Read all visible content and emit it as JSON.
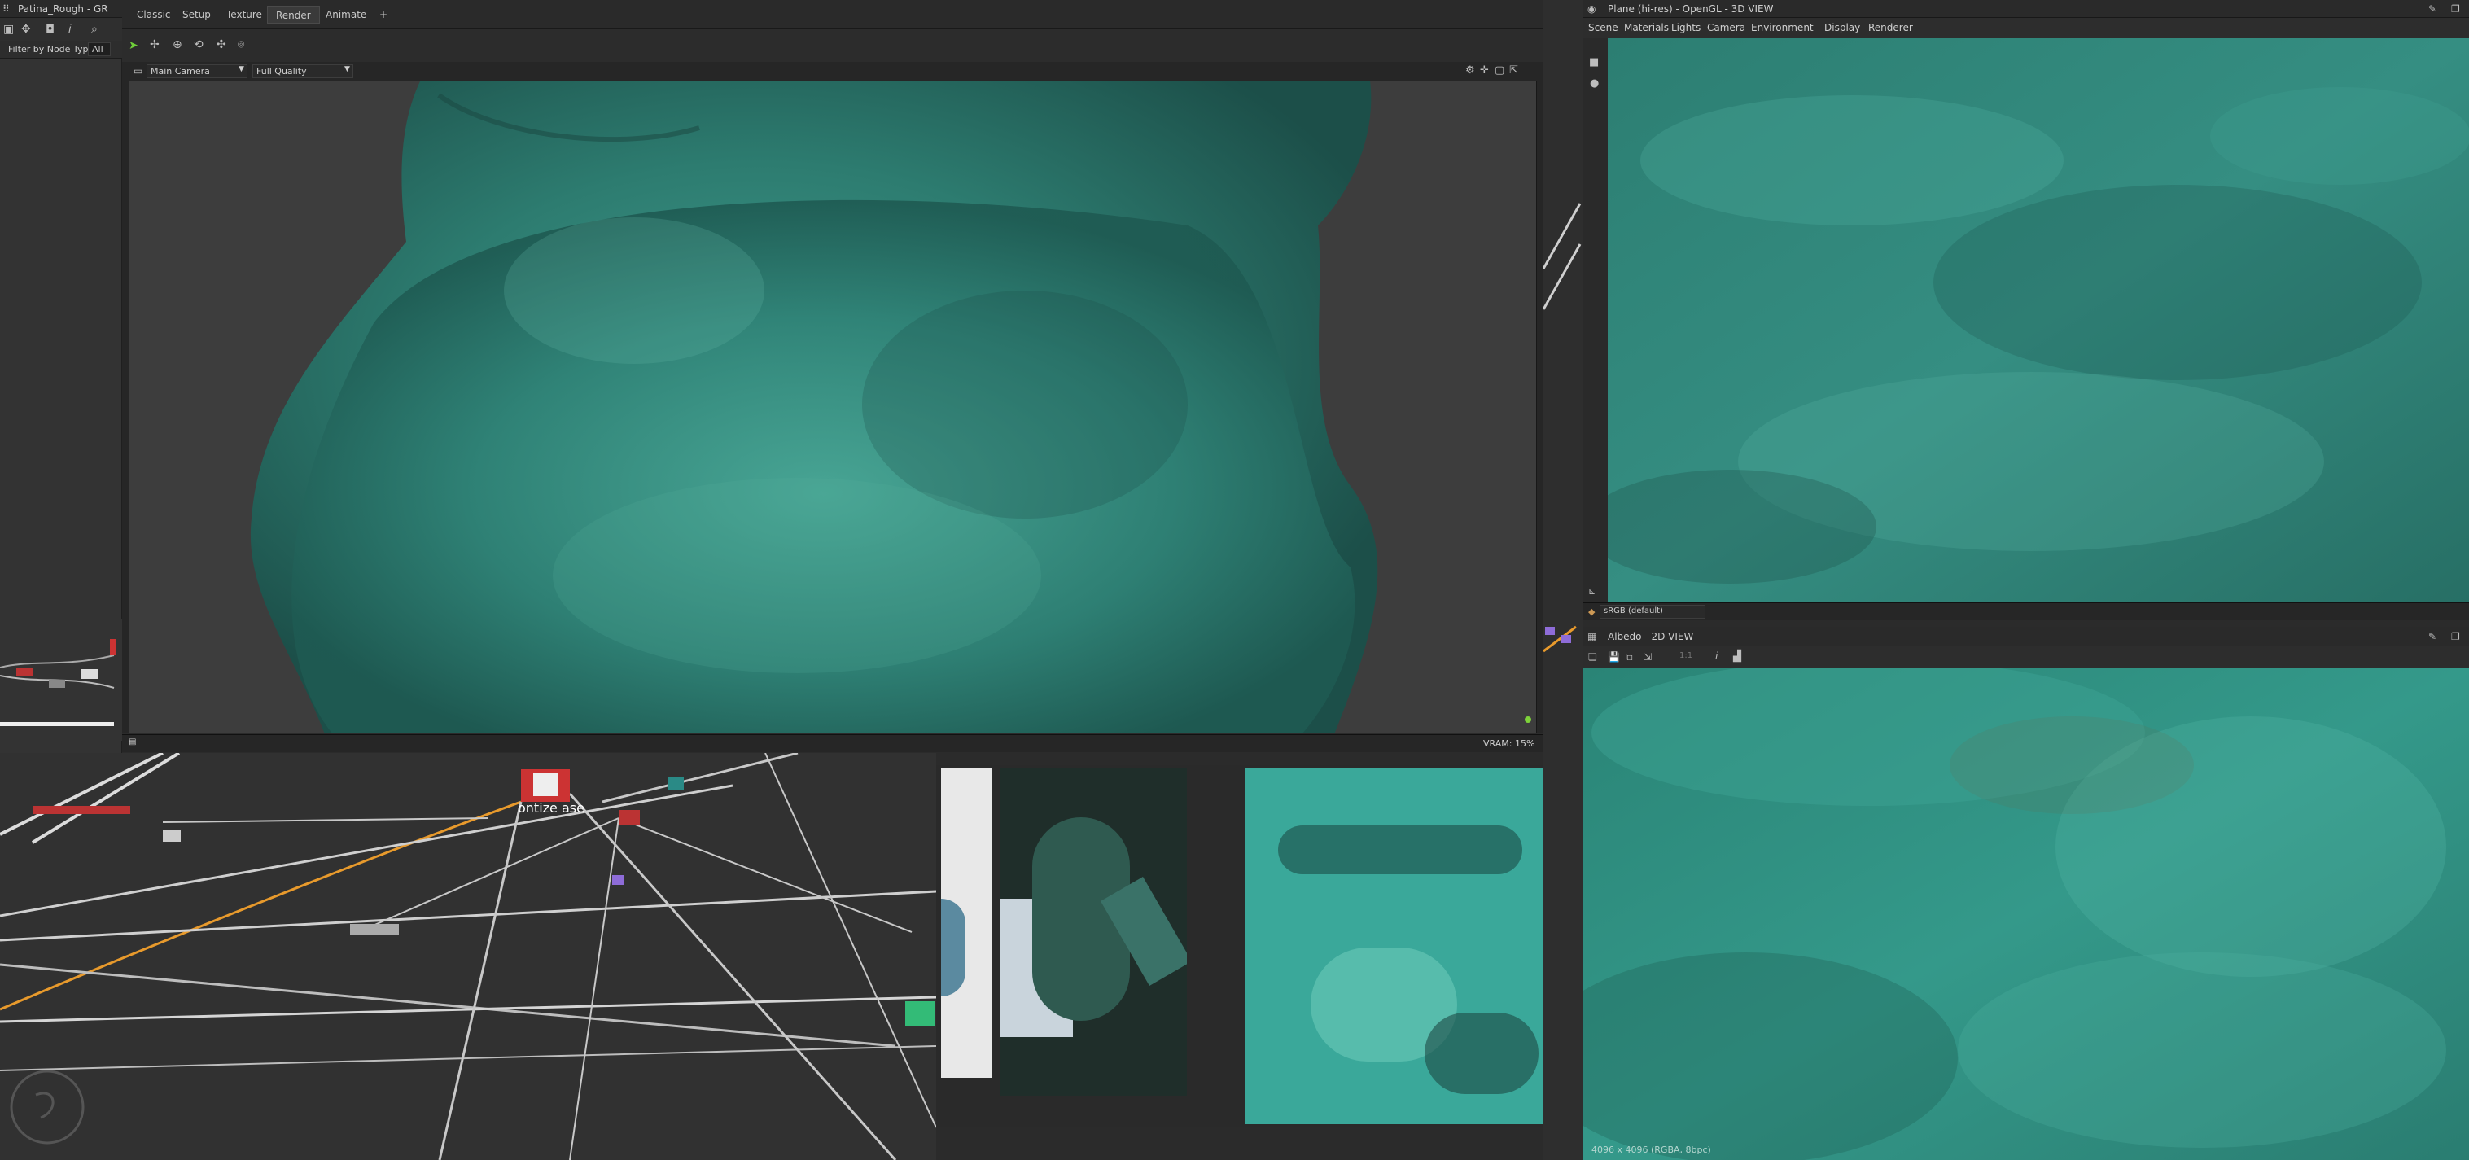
{
  "app": {
    "window_title": "Patina_Rough - GR"
  },
  "graph_panel": {
    "filter_label": "Filter by Node Type:",
    "filter_value": "All"
  },
  "workspace_tabs": [
    "Classic",
    "Setup",
    "Texture",
    "Render",
    "Animate",
    "+"
  ],
  "active_tab": "Render",
  "viewport": {
    "camera": "Main Camera",
    "quality": "Full Quality",
    "vram": "VRAM: 15%"
  },
  "node_graph": {
    "node_label": "ontize ase"
  },
  "view3d": {
    "title": "Plane (hi-res) - OpenGL - 3D VIEW",
    "menu": [
      "Scene",
      "Materials",
      "Lights",
      "Camera",
      "Environment",
      "Display",
      "Renderer"
    ],
    "color_space": "sRGB (default)"
  },
  "view2d": {
    "title": "Albedo - 2D VIEW",
    "status": "4096 x 4096 (RGBA, 8bpc)",
    "zoom_value": "1:1"
  },
  "colors": {
    "patina": "#2e8b7d",
    "background": "#2b2b2b",
    "orange_wire": "#e89a2c"
  },
  "icons": [
    "select-arrow-icon",
    "move-icon",
    "globe-icon",
    "rotate-icon",
    "camera-icon",
    "gear-icon",
    "pin-icon",
    "maximize-icon",
    "close-icon",
    "save-icon",
    "info-icon",
    "histogram-icon",
    "light-bulb-icon"
  ]
}
